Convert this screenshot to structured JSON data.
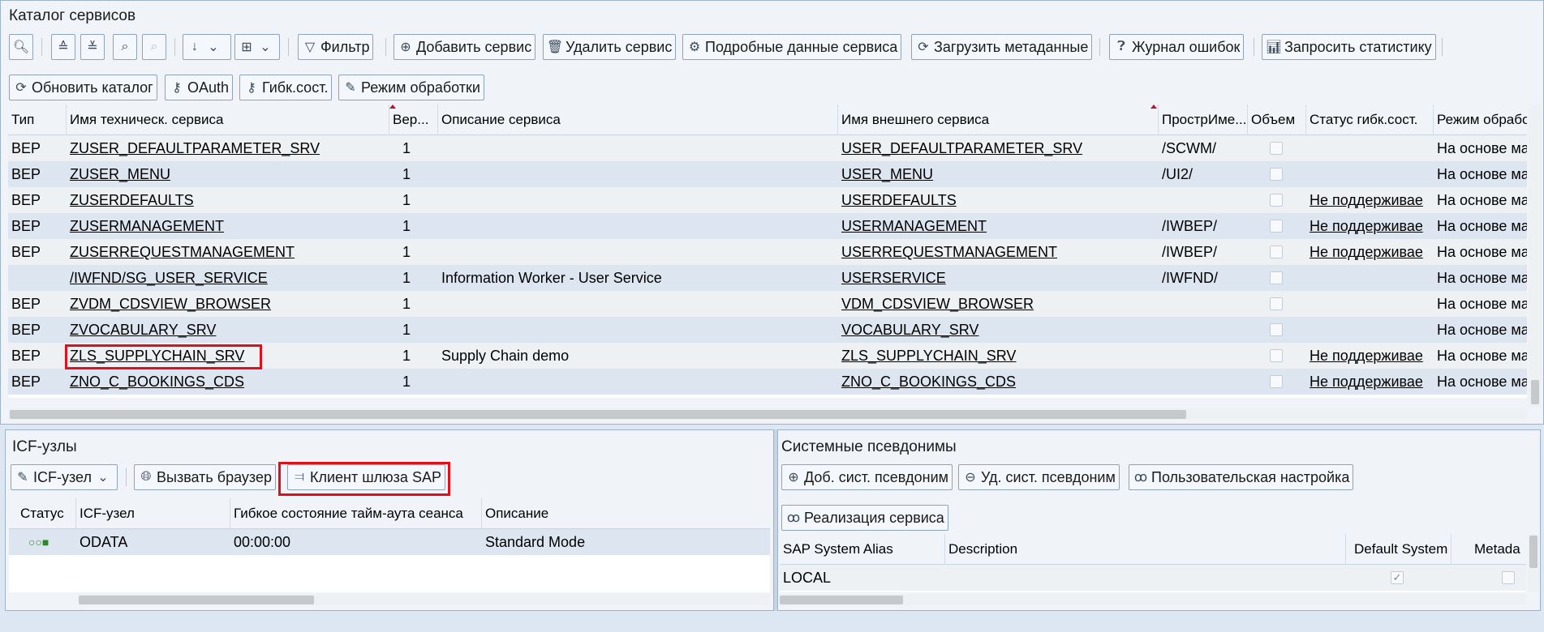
{
  "catalog": {
    "title": "Каталог сервисов",
    "toolbar": {
      "filter": "Фильтр",
      "add_service": "Добавить сервис",
      "delete_service": "Удалить сервис",
      "service_details": "Подробные данные сервиса",
      "load_metadata": "Загрузить метаданные",
      "error_log": "Журнал ошибок",
      "request_stats": "Запросить статистику",
      "refresh_catalog": "Обновить каталог",
      "oauth": "OAuth",
      "soft_state": "Гибк.сост.",
      "processing_mode": "Режим обработки"
    },
    "columns": [
      "Тип",
      "Имя техническ. сервиса",
      "Вер...",
      "Описание сервиса",
      "Имя внешнего сервиса",
      "ПрострИме...",
      "Объем",
      "Статус гибк.сост.",
      "Режим обрабо"
    ],
    "rows": [
      {
        "type": "BEP",
        "tech": "ZUSER_DEFAULTPARAMETER_SRV",
        "ver": "1",
        "desc": "",
        "ext": "USER_DEFAULTPARAMETER_SRV",
        "ns": "/SCWM/",
        "status": "",
        "mode": "На основе ма"
      },
      {
        "type": "BEP",
        "tech": "ZUSER_MENU",
        "ver": "1",
        "desc": "",
        "ext": "USER_MENU",
        "ns": "/UI2/",
        "status": "",
        "mode": "На основе ма"
      },
      {
        "type": "BEP",
        "tech": "ZUSERDEFAULTS",
        "ver": "1",
        "desc": "",
        "ext": "USERDEFAULTS",
        "ns": "",
        "status": "Не поддерживае",
        "mode": "На основе ма"
      },
      {
        "type": "BEP",
        "tech": "ZUSERMANAGEMENT",
        "ver": "1",
        "desc": "",
        "ext": "USERMANAGEMENT",
        "ns": "/IWBEP/",
        "status": "Не поддерживае",
        "mode": "На основе ма"
      },
      {
        "type": "BEP",
        "tech": "ZUSERREQUESTMANAGEMENT",
        "ver": "1",
        "desc": "",
        "ext": "USERREQUESTMANAGEMENT",
        "ns": "/IWBEP/",
        "status": "Не поддерживае",
        "mode": "На основе ма"
      },
      {
        "type": "",
        "tech": "/IWFND/SG_USER_SERVICE",
        "ver": "1",
        "desc": "Information Worker - User Service",
        "ext": "USERSERVICE",
        "ns": "/IWFND/",
        "status": "",
        "mode": "На основе ма"
      },
      {
        "type": "BEP",
        "tech": "ZVDM_CDSVIEW_BROWSER",
        "ver": "1",
        "desc": "",
        "ext": "VDM_CDSVIEW_BROWSER",
        "ns": "",
        "status": "",
        "mode": "На основе ма"
      },
      {
        "type": "BEP",
        "tech": "ZVOCABULARY_SRV",
        "ver": "1",
        "desc": "",
        "ext": "VOCABULARY_SRV",
        "ns": "",
        "status": "",
        "mode": "На основе ма"
      },
      {
        "type": "BEP",
        "tech": "ZLS_SUPPLYCHAIN_SRV",
        "ver": "1",
        "desc": "Supply Chain demo",
        "ext": "ZLS_SUPPLYCHAIN_SRV",
        "ns": "",
        "status": "Не поддерживае",
        "mode": "На основе ма"
      },
      {
        "type": "BEP",
        "tech": "ZNO_C_BOOKINGS_CDS",
        "ver": "1",
        "desc": "",
        "ext": "ZNO_C_BOOKINGS_CDS",
        "ns": "",
        "status": "Не поддерживае",
        "mode": "На основе ма"
      }
    ]
  },
  "icf": {
    "title": "ICF-узлы",
    "toolbar": {
      "icf_node": "ICF-узел",
      "call_browser": "Вызвать браузер",
      "gateway_client": "Клиент шлюза SAP"
    },
    "columns": [
      "Статус",
      "ICF-узел",
      "Гибкое состояние тайм-аута сеанса",
      "Описание"
    ],
    "rows": [
      {
        "status_icon": "○○■",
        "node": "ODATA",
        "timeout": "00:00:00",
        "desc": "Standard Mode"
      }
    ]
  },
  "aliases": {
    "title": "Системные псевдонимы",
    "toolbar": {
      "add_alias": "Доб. сист. псевдоним",
      "del_alias": "Уд. сист. псевдоним",
      "user_settings": "Пользовательская настройка",
      "service_impl": "Реализация сервиса"
    },
    "columns": [
      "SAP System Alias",
      "Description",
      "Default System",
      "Metada"
    ],
    "rows": [
      {
        "alias": "LOCAL",
        "desc": "",
        "default": true,
        "meta": false
      }
    ]
  },
  "colors": {
    "highlight": "#e0101a",
    "row_odd": "#eef1f4",
    "row_even": "#dde6f0",
    "panel_bg": "#f0f4f9"
  }
}
